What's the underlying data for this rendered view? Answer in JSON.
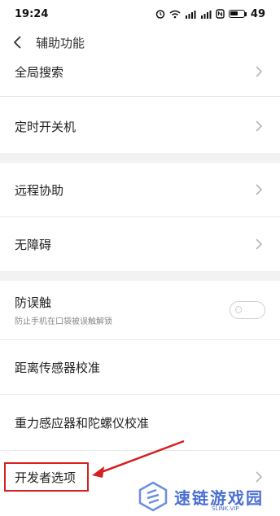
{
  "status": {
    "time": "19:24",
    "battery": "49"
  },
  "header": {
    "title": "辅助功能"
  },
  "items": [
    {
      "label": "全局搜索"
    },
    {
      "label": "定时开关机"
    },
    {
      "label": "远程协助"
    },
    {
      "label": "无障碍"
    },
    {
      "label": "防误触",
      "sub": "防止手机在口袋被误触解锁"
    },
    {
      "label": "距离传感器校准"
    },
    {
      "label": "重力感应器和陀螺仪校准"
    },
    {
      "label": "开发者选项"
    }
  ],
  "watermark": {
    "text": "速链游戏园",
    "sub": "SLINK.VIP"
  },
  "colors": {
    "highlight": "#d61f1f",
    "watermark": "#4a6fd0",
    "section_gap": "#f2f2f2"
  }
}
